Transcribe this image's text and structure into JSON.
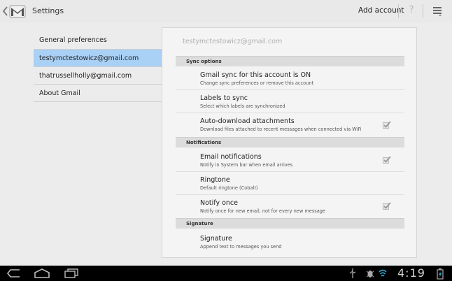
{
  "actionbar": {
    "title": "Settings",
    "add_account": "Add account",
    "help_icon": "question-icon",
    "menu_icon": "overflow-menu-icon"
  },
  "left_list": [
    {
      "label": "General preferences",
      "selected": false
    },
    {
      "label": "testymctestowicz@gmail.com",
      "selected": true
    },
    {
      "label": "thatrussellholly@gmail.com",
      "selected": false
    },
    {
      "label": "About Gmail",
      "selected": false
    }
  ],
  "panel": {
    "account": "testymctestowicz@gmail.com",
    "sections": {
      "sync": "Sync options",
      "notifications": "Notifications",
      "signature": "Signature"
    },
    "items": {
      "gmail_sync": {
        "title": "Gmail sync for this account is ON",
        "summary": "Change sync preferences or remove this account"
      },
      "labels_sync": {
        "title": "Labels to sync",
        "summary": "Select which labels are synchronized"
      },
      "auto_download": {
        "title": "Auto-download attachments",
        "summary": "Download files attached to recent messages when connected via WiFi",
        "checked": true
      },
      "email_notifications": {
        "title": "Email notifications",
        "summary": "Notify in System bar when email arrives",
        "checked": true
      },
      "ringtone": {
        "title": "Ringtone",
        "summary": "Default ringtone (Cobalt)"
      },
      "notify_once": {
        "title": "Notify once",
        "summary": "Notify once for new email, not for every new message",
        "checked": true
      },
      "signature": {
        "title": "Signature",
        "summary": "Append text to messages you send"
      }
    }
  },
  "system_bar": {
    "time": "4:19",
    "accent": "#33b5e5"
  }
}
